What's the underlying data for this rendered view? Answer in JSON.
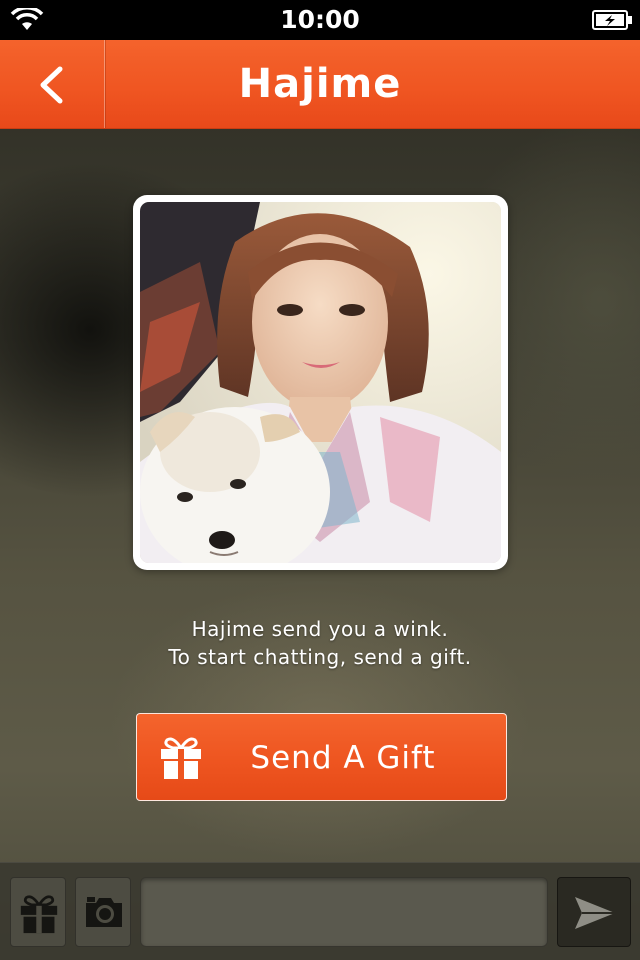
{
  "status_bar": {
    "time": "10:00",
    "icons": [
      "wifi-icon",
      "battery-charging-icon"
    ]
  },
  "nav": {
    "title": "Hajime",
    "back_icon": "chevron-left-icon"
  },
  "profile": {
    "photo": "profile-photo-icon"
  },
  "message": {
    "line1": "Hajime send you a wink.",
    "line2": "To start chatting, send a gift."
  },
  "send_gift_button": {
    "label": "Send A Gift",
    "icon": "gift-icon"
  },
  "toolbar": {
    "gift_icon": "gift-icon",
    "camera_icon": "camera-icon",
    "input_value": "",
    "input_placeholder": "",
    "send_icon": "send-arrow-icon"
  },
  "colors": {
    "accent": "#f05622",
    "toolbar_bg": "#3a3930",
    "text_on_accent": "#ffffff"
  }
}
